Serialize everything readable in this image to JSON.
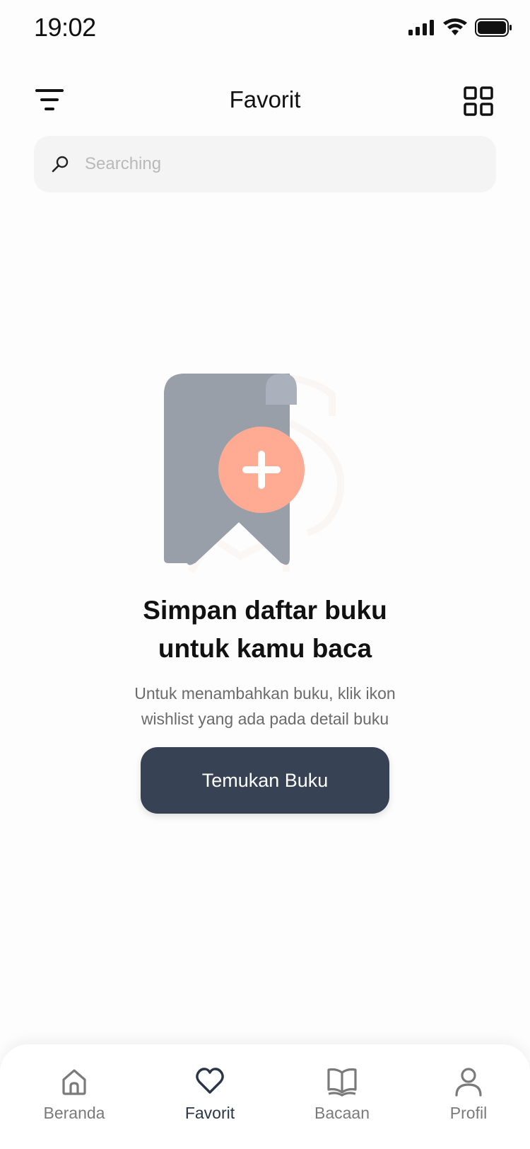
{
  "status_bar": {
    "time": "19:02"
  },
  "header": {
    "title": "Favorit"
  },
  "search": {
    "placeholder": "Searching"
  },
  "empty_state": {
    "title_line1": "Simpan daftar buku",
    "title_line2": "untuk kamu baca",
    "subtitle_line1": "Untuk menambahkan buku, klik ikon",
    "subtitle_line2": "wishlist yang ada pada detail buku",
    "button_label": "Temukan Buku"
  },
  "bottom_nav": {
    "items": [
      {
        "label": "Beranda",
        "icon": "home-icon",
        "active": false
      },
      {
        "label": "Favorit",
        "icon": "heart-icon",
        "active": true
      },
      {
        "label": "Bacaan",
        "icon": "open-book-icon",
        "active": false
      },
      {
        "label": "Profil",
        "icon": "person-icon",
        "active": false
      }
    ]
  },
  "colors": {
    "primary": "#374255",
    "accent": "#ffab94",
    "bookmark": "#989fa9",
    "search_bg": "#f4f4f4"
  }
}
